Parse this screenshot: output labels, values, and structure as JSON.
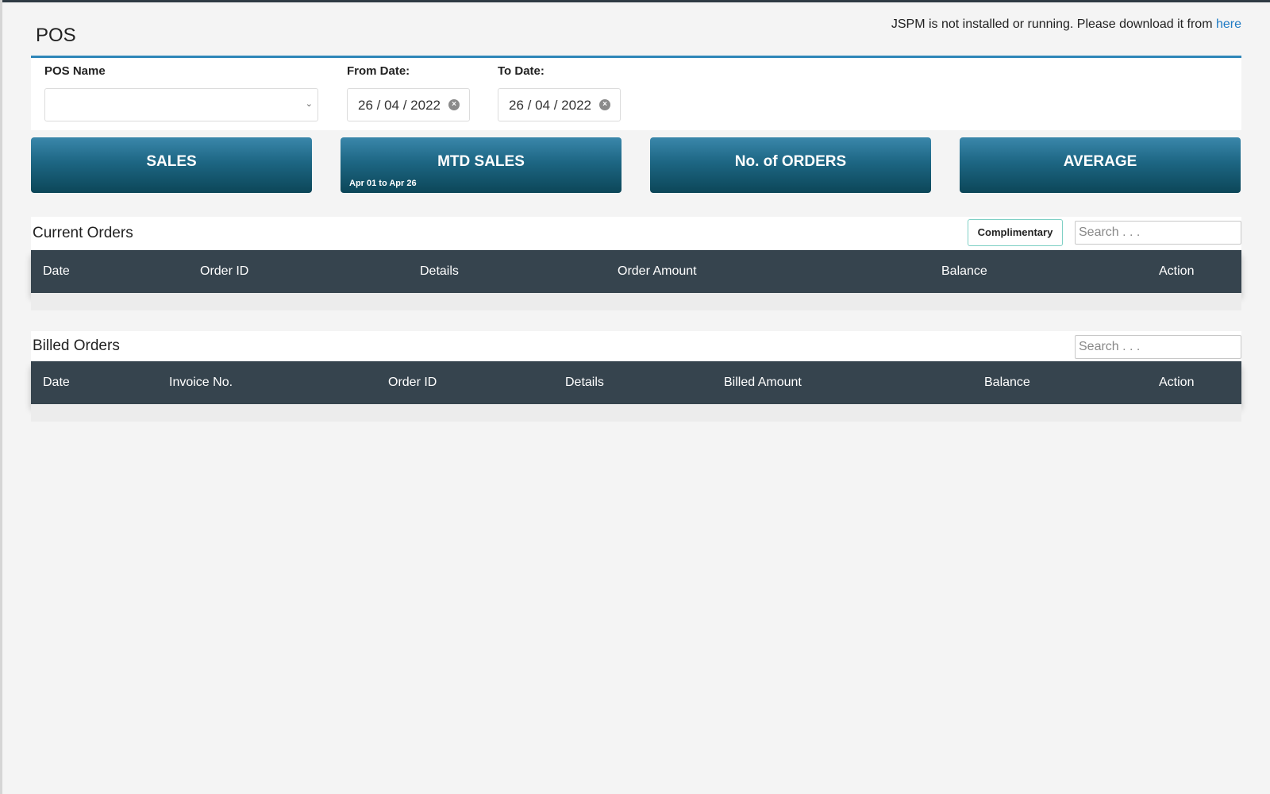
{
  "page": {
    "title": "POS",
    "notice": {
      "text": "JSPM is not installed or running. Please download it from ",
      "link_text": "here"
    }
  },
  "filters": {
    "pos_name_label": "POS Name",
    "pos_name_value": "",
    "from_date_label": "From Date:",
    "from_date_value": "26 / 04 / 2022",
    "to_date_label": "To Date:",
    "to_date_value": "26 / 04 / 2022"
  },
  "stats": {
    "sales": "SALES",
    "mtd_sales": "MTD SALES",
    "mtd_range": "Apr 01 to Apr 26",
    "orders": "No. of ORDERS",
    "average": "AVERAGE"
  },
  "current_orders": {
    "title": "Current Orders",
    "complimentary_label": "Complimentary",
    "search_placeholder": "Search . . .",
    "columns": [
      "Date",
      "Order ID",
      "Details",
      "Order Amount",
      "Balance",
      "Action"
    ]
  },
  "billed_orders": {
    "title": "Billed Orders",
    "search_placeholder": "Search . . .",
    "columns": [
      "Date",
      "Invoice No.",
      "Order ID",
      "Details",
      "Billed Amount",
      "Balance",
      "Action"
    ]
  },
  "colors": {
    "accent_rule": "#2f86b8",
    "button_gradient_top": "#3a87ab",
    "button_gradient_bottom": "#0c4658",
    "table_header": "#36444e",
    "link": "#1f7bc4"
  },
  "icons": {
    "dropdown": "chevron-down-icon",
    "date_clear": "clear-circle-icon"
  }
}
